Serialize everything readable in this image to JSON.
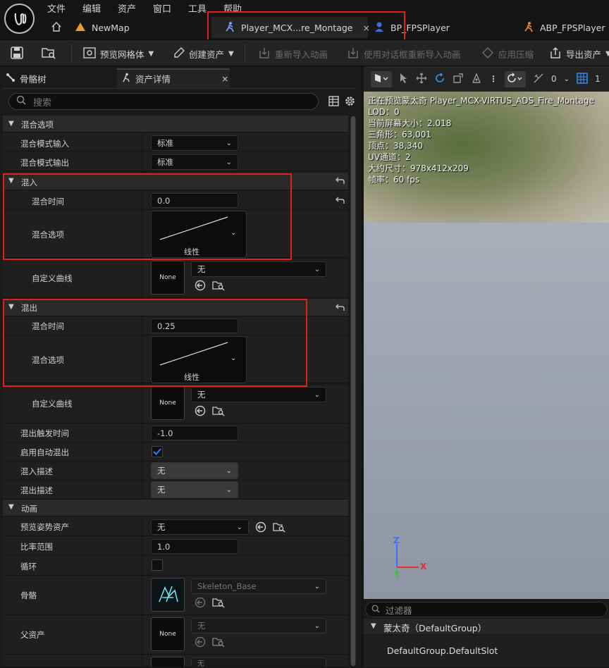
{
  "menu": [
    "文件",
    "编辑",
    "资产",
    "窗口",
    "工具",
    "帮助"
  ],
  "tabs": {
    "newmap": "NewMap",
    "montage": "Player_MCX...re_Montage",
    "bp": "BP_FPSPlayer",
    "abp": "ABP_FPSPlayer"
  },
  "toolbar": {
    "preview_mesh": "预览网格体",
    "create_asset": "创建资产",
    "reimport": "重新导入动画",
    "reimport_dialog": "使用对话框重新导入动画",
    "apply_compression": "应用压缩",
    "export_asset": "导出资产"
  },
  "panel_tabs": {
    "skeleton_tree": "骨骼树",
    "asset_details": "资产详情"
  },
  "search": {
    "placeholder": "搜索"
  },
  "details": {
    "blend_options_cat": "混合选项",
    "blend_mode_in_label": "混合模式输入",
    "blend_mode_in_value": "标准",
    "blend_mode_out_label": "混合模式输出",
    "blend_mode_out_value": "标准",
    "blend_in_cat": "混入",
    "blend_in_time_label": "混合时间",
    "blend_in_time_value": "0.0",
    "blend_in_option_label": "混合选项",
    "blend_in_option_value": "线性",
    "blend_in_curve_label": "自定义曲线",
    "blend_in_curve_thumb": "None",
    "blend_in_curve_value": "无",
    "blend_out_cat": "混出",
    "blend_out_time_label": "混合时间",
    "blend_out_time_value": "0.25",
    "blend_out_option_label": "混合选项",
    "blend_out_option_value": "线性",
    "blend_out_curve_label": "自定义曲线",
    "blend_out_curve_thumb": "None",
    "blend_out_curve_value": "无",
    "blend_out_trigger_label": "混出触发时间",
    "blend_out_trigger_value": "-1.0",
    "auto_blend_out_label": "启用自动混出",
    "auto_blend_out_checked": true,
    "blend_in_desc_label": "混入描述",
    "blend_in_desc_value": "无",
    "blend_out_desc_label": "混出描述",
    "blend_out_desc_value": "无",
    "animation_cat": "动画",
    "preview_pose_label": "预览姿势资产",
    "preview_pose_value": "无",
    "rate_scale_label": "比率范围",
    "rate_scale_value": "1.0",
    "loop_label": "循环",
    "loop_checked": false,
    "skeleton_label": "骨骼",
    "skeleton_value": "Skeleton_Base",
    "parent_label": "父资产",
    "parent_thumb": "None",
    "parent_value": "无",
    "extra_value": "无"
  },
  "viewport": {
    "toolbar_num": "0",
    "toolbar_num2": "1",
    "stats": [
      "正在预览蒙太奇 Player_MCX-VIRTUS_ADS_Fire_Montage",
      "LOD：0",
      "当前屏幕大小：2.018",
      "三角形：63,001",
      "顶点：38,340",
      "UV通道：2",
      "大约尺寸：978x412x209",
      "帧率：60 fps"
    ],
    "axis_z": "Z",
    "axis_x": "X",
    "axis_y": "Y"
  },
  "slots": {
    "filter_placeholder": "过滤器",
    "group": "蒙太奇（DefaultGroup）",
    "slot": "DefaultGroup.DefaultSlot"
  },
  "colors": {
    "accent": "#2a7fff",
    "highlight": "#e02020",
    "panel": "#1f1f1f"
  }
}
